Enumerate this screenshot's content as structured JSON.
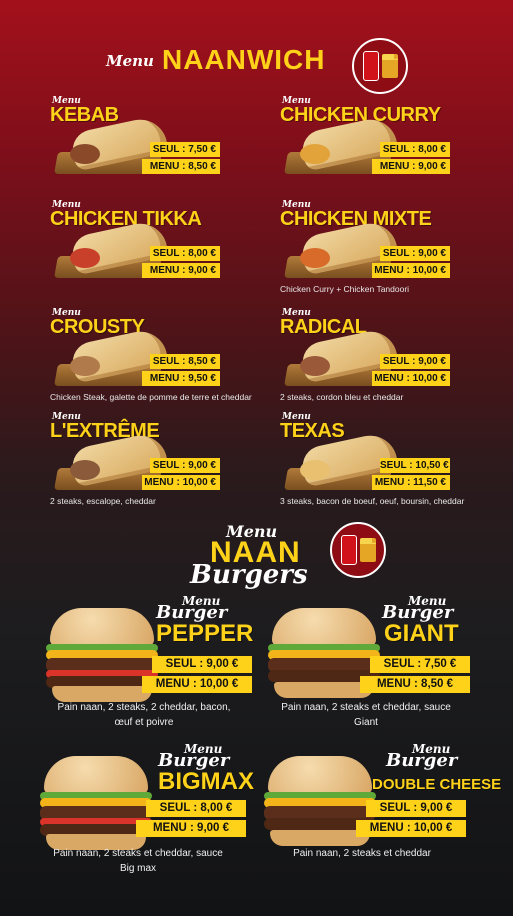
{
  "header_naanwich": {
    "menu_script": "Menu",
    "title": "NAANWICH",
    "badge_text": "Servi avec frites et 1 boisson au choix",
    "badge_brand": "Coca-Cola"
  },
  "naanwich_items": [
    {
      "menu": "Menu",
      "name": "KEBAB",
      "seul": "SEUL : 7,50 €",
      "menu_price": "MENU : 8,50 €",
      "desc": ""
    },
    {
      "menu": "Menu",
      "name": "CHICKEN CURRY",
      "seul": "SEUL : 8,00 €",
      "menu_price": "MENU : 9,00 €",
      "desc": ""
    },
    {
      "menu": "Menu",
      "name": "CHICKEN TIKKA",
      "seul": "SEUL : 8,00 €",
      "menu_price": "MENU : 9,00 €",
      "desc": ""
    },
    {
      "menu": "Menu",
      "name": "CHICKEN MIXTE",
      "seul": "SEUL : 9,00 €",
      "menu_price": "MENU : 10,00 €",
      "desc": "Chicken Curry + Chicken Tandoori"
    },
    {
      "menu": "Menu",
      "name": "CROUSTY",
      "seul": "SEUL : 8,50 €",
      "menu_price": "MENU : 9,50 €",
      "desc": "Chicken Steak, galette de pomme de terre et cheddar"
    },
    {
      "menu": "Menu",
      "name": "RADICAL",
      "seul": "SEUL : 9,00 €",
      "menu_price": "MENU : 10,00 €",
      "desc": "2 steaks, cordon bleu et cheddar"
    },
    {
      "menu": "Menu",
      "name": "L'EXTRÊME",
      "seul": "SEUL : 9,00 €",
      "menu_price": "MENU : 10,00 €",
      "desc": "2 steaks, escalope, cheddar"
    },
    {
      "menu": "Menu",
      "name": "TEXAS",
      "seul": "SEUL : 10,50 €",
      "menu_price": "MENU : 11,50 €",
      "desc": "3 steaks, bacon de boeuf, oeuf, boursin, cheddar"
    }
  ],
  "header_burgers": {
    "menu_script": "Menu",
    "title": "NAAN",
    "subtitle_script": "Burgers",
    "badge_text": "Servi avec frites et 1 boisson au choix",
    "badge_brand": "Coca-Cola"
  },
  "burgers": [
    {
      "menu": "Menu",
      "burger": "Burger",
      "name": "PEPPER",
      "seul": "SEUL : 9,00 €",
      "menu_price": "MENU : 10,00 €",
      "desc": "Pain naan, 2 steaks, 2 cheddar, bacon, œuf et poivre"
    },
    {
      "menu": "Menu",
      "burger": "Burger",
      "name": "GIANT",
      "seul": "SEUL : 7,50 €",
      "menu_price": "MENU : 8,50 €",
      "desc": "Pain naan, 2 steaks et cheddar, sauce Giant"
    },
    {
      "menu": "Menu",
      "burger": "Burger",
      "name": "BIGMAX",
      "seul": "SEUL : 8,00 €",
      "menu_price": "MENU : 9,00 €",
      "desc": "Pain naan, 2 steaks et cheddar, sauce Big max"
    },
    {
      "menu": "Menu",
      "burger": "Burger",
      "name": "DOUBLE CHEESE",
      "seul": "SEUL : 9,00 €",
      "menu_price": "MENU : 10,00 €",
      "desc": "Pain naan, 2 steaks et cheddar"
    }
  ],
  "colors": {
    "accent": "#ffd21a",
    "top_red": "#a3101b",
    "bottom_dark": "#121314"
  }
}
